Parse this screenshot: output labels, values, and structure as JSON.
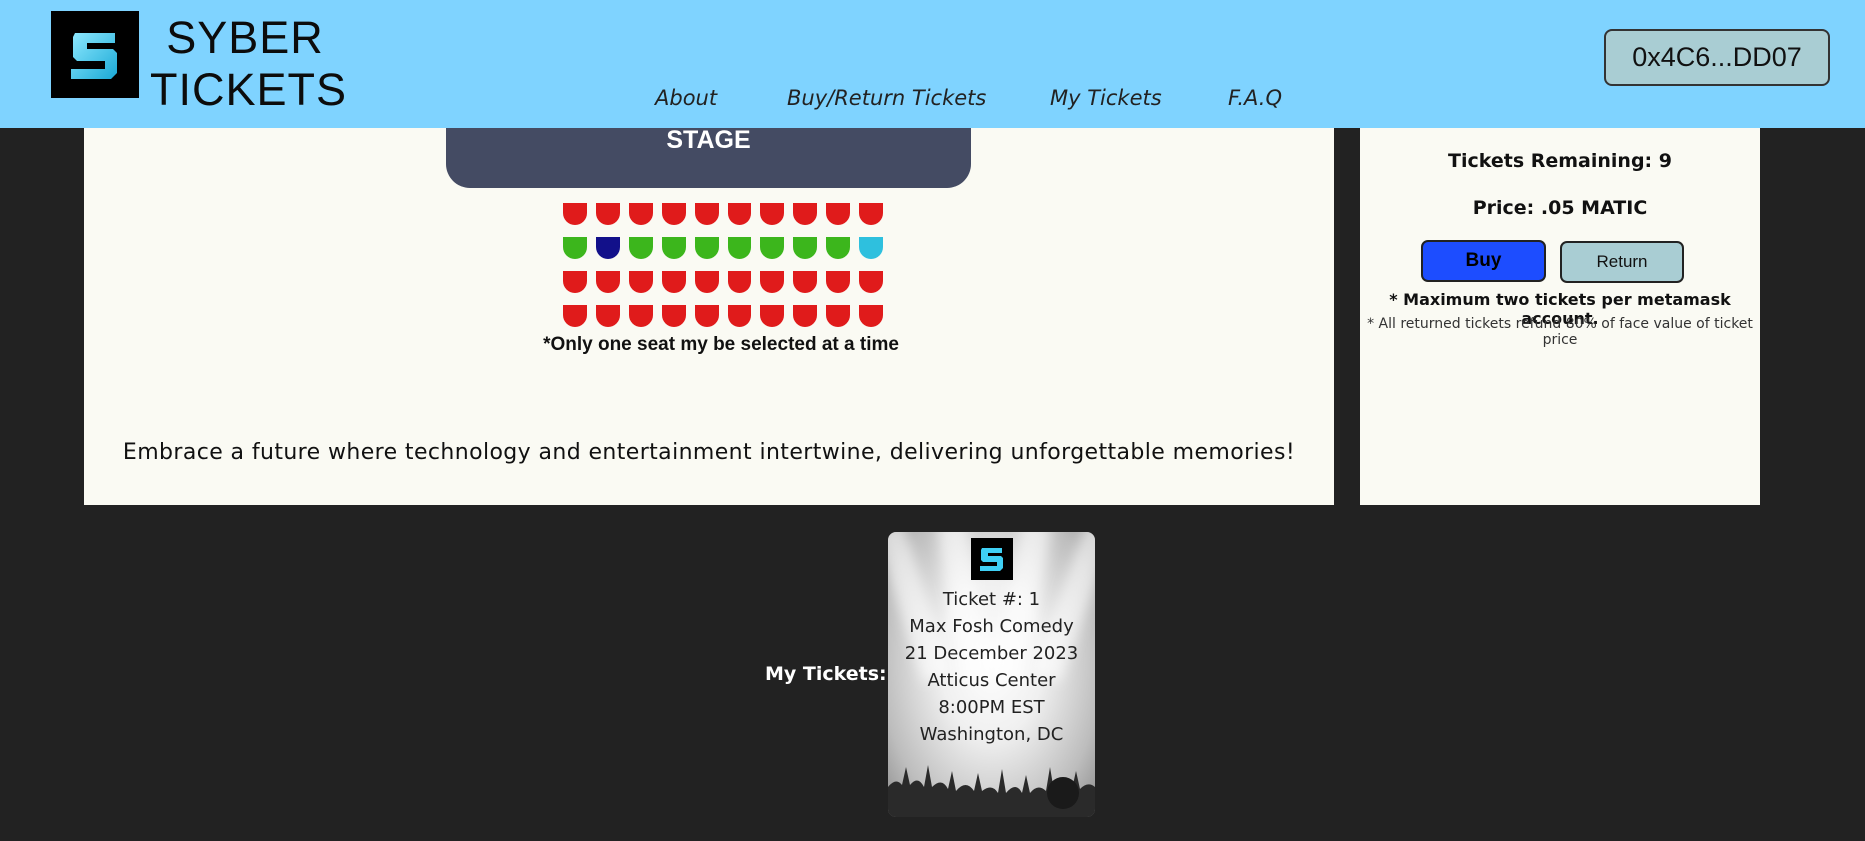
{
  "header": {
    "brand_line1": "SYBER",
    "brand_line2": "TICKETS",
    "logo_icon": "syber-s-logo-icon",
    "nav": [
      "About",
      "Buy/Return Tickets",
      "My Tickets",
      "F.A.Q"
    ],
    "wallet": "0x4C6...DD07"
  },
  "venue": {
    "stage_label": "STAGE",
    "seat_rows": [
      [
        "red",
        "red",
        "red",
        "red",
        "red",
        "red",
        "red",
        "red",
        "red",
        "red"
      ],
      [
        "green",
        "selected",
        "green",
        "green",
        "green",
        "green",
        "green",
        "green",
        "green",
        "cyan"
      ],
      [
        "red",
        "red",
        "red",
        "red",
        "red",
        "red",
        "red",
        "red",
        "red",
        "red"
      ],
      [
        "red",
        "red",
        "red",
        "red",
        "red",
        "red",
        "red",
        "red",
        "red",
        "red"
      ]
    ],
    "seat_note": "*Only one seat my be selected at a time",
    "tagline": "Embrace a future where technology and entertainment intertwine, delivering unforgettable memories!"
  },
  "purchase": {
    "remaining": "Tickets Remaining: 9",
    "price": "Price: .05 MATIC",
    "buy_label": "Buy",
    "return_label": "Return",
    "note_max": "* Maximum two tickets per metamask account.",
    "note_refund": "* All returned tickets refund 80% of face value of ticket price"
  },
  "my_tickets": {
    "label": "My Tickets:",
    "tickets": [
      {
        "number": "Ticket #: 1",
        "event": "Max Fosh Comedy",
        "date": "21 December 2023",
        "venue": "Atticus Center",
        "time": "8:00PM EST",
        "city": "Washington, DC"
      }
    ]
  },
  "colors": {
    "header_bg": "#7fd3ff",
    "page_bg": "#222222",
    "panel_bg": "#fafaf3",
    "seat_taken": "#e01b1b",
    "seat_available": "#3cb61c",
    "seat_selected": "#12108a",
    "seat_highlight": "#2ec0de",
    "buy_button": "#1d4dff"
  }
}
